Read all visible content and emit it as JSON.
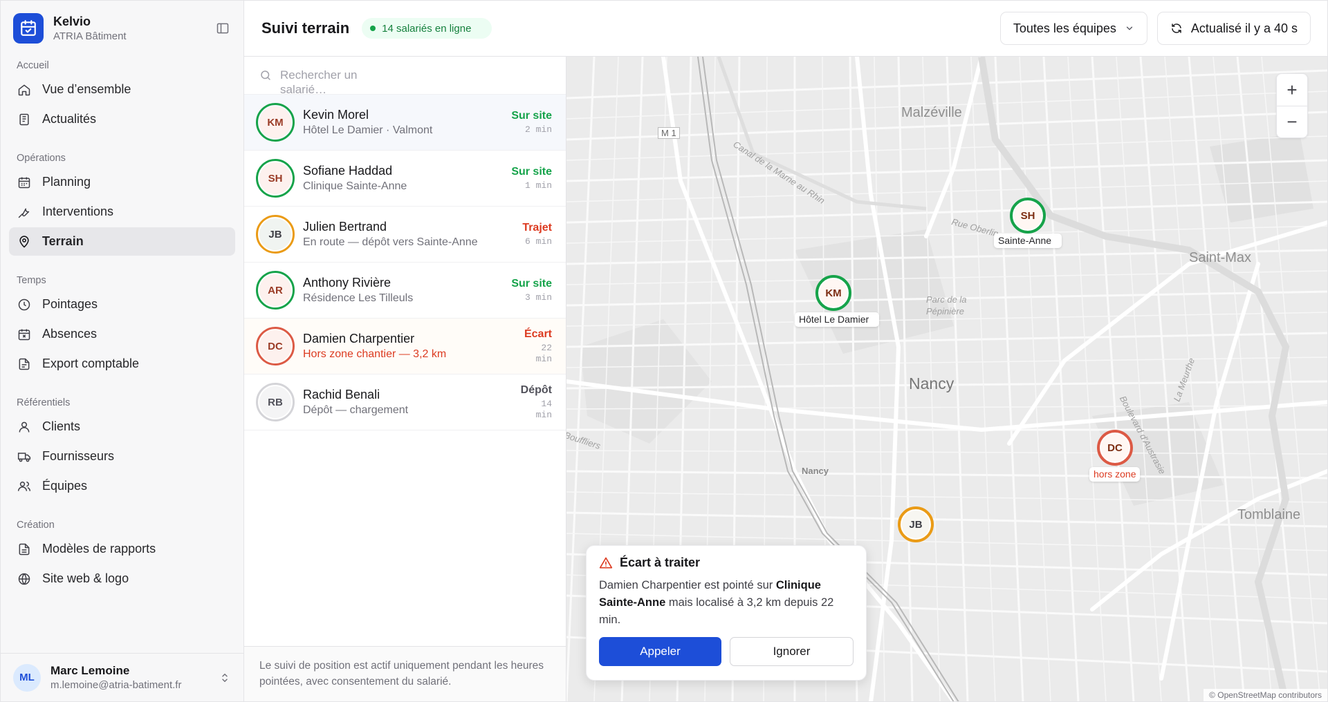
{
  "brand": {
    "name": "Kelvio",
    "company": "ATRIA Bâtiment"
  },
  "nav": {
    "sections": [
      {
        "title": "Accueil",
        "items": [
          {
            "label": "Vue d’ensemble",
            "icon": "home-icon"
          },
          {
            "label": "Actualités",
            "icon": "news-icon"
          }
        ]
      },
      {
        "title": "Opérations",
        "items": [
          {
            "label": "Planning",
            "icon": "calendar-icon"
          },
          {
            "label": "Interventions",
            "icon": "wrench-icon"
          },
          {
            "label": "Terrain",
            "icon": "map-pin-icon",
            "active": true
          }
        ]
      },
      {
        "title": "Temps",
        "items": [
          {
            "label": "Pointages",
            "icon": "clock-icon"
          },
          {
            "label": "Absences",
            "icon": "calendar-x-icon"
          },
          {
            "label": "Export comptable",
            "icon": "file-icon"
          }
        ]
      },
      {
        "title": "Référentiels",
        "items": [
          {
            "label": "Clients",
            "icon": "user-icon"
          },
          {
            "label": "Fournisseurs",
            "icon": "truck-icon"
          },
          {
            "label": "Équipes",
            "icon": "users-icon"
          }
        ]
      },
      {
        "title": "Création",
        "items": [
          {
            "label": "Modèles de rapports",
            "icon": "document-icon"
          },
          {
            "label": "Site web & logo",
            "icon": "globe-icon"
          }
        ]
      }
    ]
  },
  "user": {
    "initials": "ML",
    "name": "Marc Lemoine",
    "email": "m.lemoine@atria-batiment.fr"
  },
  "header": {
    "title": "Suivi terrain",
    "online_badge": "14 salariés en ligne",
    "team_filter": "Toutes les équipes",
    "refresh_label": "Actualisé il y a 40 s"
  },
  "search": {
    "placeholder": "Rechercher un salarié…"
  },
  "employees": [
    {
      "initials": "KM",
      "name": "Kevin Morel",
      "location": "Hôtel Le Damier · Valmont",
      "status": "Sur site",
      "time": "2 min",
      "tone": "green"
    },
    {
      "initials": "SH",
      "name": "Sofiane Haddad",
      "location": "Clinique Sainte-Anne",
      "status": "Sur site",
      "time": "1 min",
      "tone": "green"
    },
    {
      "initials": "JB",
      "name": "Julien Bertrand",
      "location": "En route — dépôt vers Sainte-Anne",
      "status": "Trajet",
      "time": "6 min",
      "tone": "orange"
    },
    {
      "initials": "AR",
      "name": "Anthony Rivière",
      "location": "Résidence Les Tilleuls",
      "status": "Sur site",
      "time": "3 min",
      "tone": "green"
    },
    {
      "initials": "DC",
      "name": "Damien Charpentier",
      "location": "Hors zone chantier — 3,2 km",
      "status": "Écart",
      "time": "22 min",
      "tone": "red"
    },
    {
      "initials": "RB",
      "name": "Rachid Benali",
      "location": "Dépôt — chargement",
      "status": "Dépôt",
      "time": "14 min",
      "tone": "grey"
    }
  ],
  "footer_note": "Le suivi de position est actif uniquement pendant les heures pointées, avec consentement du salarié.",
  "map": {
    "places": [
      "Malzéville",
      "Saint-Max",
      "Nancy",
      "Tomblaine",
      "Parc de la Pépinière",
      "Rue Oberlin",
      "Boulevard d'Austrasie",
      "La Meurthe",
      "Canal de la Marne au Rhin",
      "M 1",
      "Bouffliers",
      "Nancy"
    ],
    "markers": [
      {
        "initials": "KM",
        "label": "Hôtel Le Damier",
        "tone": "green"
      },
      {
        "initials": "SH",
        "label": "Sainte-Anne",
        "tone": "green"
      },
      {
        "initials": "DC",
        "label": "hors zone",
        "tone": "red"
      },
      {
        "initials": "JB",
        "label": "",
        "tone": "orange"
      }
    ],
    "attribution": "© OpenStreetMap contributors"
  },
  "alert": {
    "title": "Écart à traiter",
    "text_before": "Damien Charpentier est pointé sur ",
    "site": "Clinique Sainte-Anne",
    "text_after": " mais localisé à 3,2 km depuis 22 min.",
    "primary": "Appeler",
    "secondary": "Ignorer"
  }
}
